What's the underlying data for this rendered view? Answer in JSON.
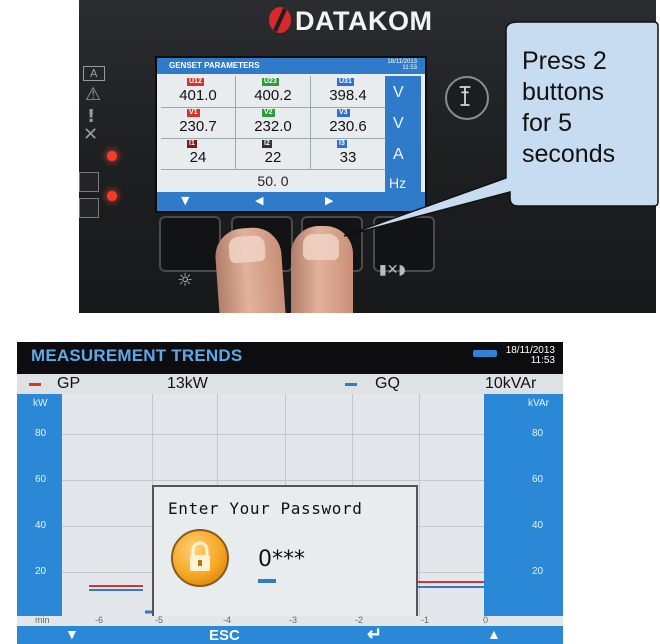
{
  "controller": {
    "brand": "DATAKOM",
    "screen": {
      "title": "GENSET PARAMETERS",
      "date": "18/11/2013",
      "time": "11:53",
      "rows": [
        {
          "cells": [
            {
              "tag": "U12",
              "value": "401.0",
              "color": "#d9342b"
            },
            {
              "tag": "U23",
              "value": "400.2",
              "color": "#2f9b3a"
            },
            {
              "tag": "U31",
              "value": "398.4",
              "color": "#2f6fd0"
            }
          ],
          "unit": "V"
        },
        {
          "cells": [
            {
              "tag": "V1",
              "value": "230.7",
              "color": "#d9342b"
            },
            {
              "tag": "V2",
              "value": "232.0",
              "color": "#2f9b3a"
            },
            {
              "tag": "V3",
              "value": "230.6",
              "color": "#2f6fd0"
            }
          ],
          "unit": "V"
        },
        {
          "cells": [
            {
              "tag": "I1",
              "value": "24",
              "color": "#7a1a1a"
            },
            {
              "tag": "I2",
              "value": "22",
              "color": "#333333"
            },
            {
              "tag": "I3",
              "value": "33",
              "color": "#2f6fd0"
            }
          ],
          "unit": "A"
        }
      ],
      "frequency": "50. 0",
      "frequency_unit": "Hz"
    }
  },
  "callout": {
    "line1": "Press 2",
    "line2": "buttons",
    "line3": "for 5",
    "line4": "seconds"
  },
  "trends": {
    "title": "MEASUREMENT TRENDS",
    "date": "18/11/2013",
    "time": "11:53",
    "legend": {
      "series1_name": "GP",
      "series1_value": "13kW",
      "series1_color": "#d9342b",
      "series2_name": "GQ",
      "series2_value": "10kVAr",
      "series2_color": "#2f7ac9"
    },
    "left_axis": {
      "unit": "kW",
      "ticks": [
        "80",
        "60",
        "40",
        "20"
      ]
    },
    "right_axis": {
      "unit": "kVAr",
      "ticks": [
        "80",
        "60",
        "40",
        "20"
      ]
    },
    "x_axis": {
      "unit": "min",
      "ticks": [
        "-6",
        "-5",
        "-4",
        "-3",
        "-2",
        "-1",
        "0"
      ]
    },
    "dialog": {
      "title": "Enter Your Password",
      "password": "0***",
      "icon": "padlock-icon"
    },
    "softkeys": {
      "left": "down-arrow-icon",
      "esc": "ESC",
      "enter": "enter-icon",
      "right": "up-arrow-icon"
    }
  }
}
